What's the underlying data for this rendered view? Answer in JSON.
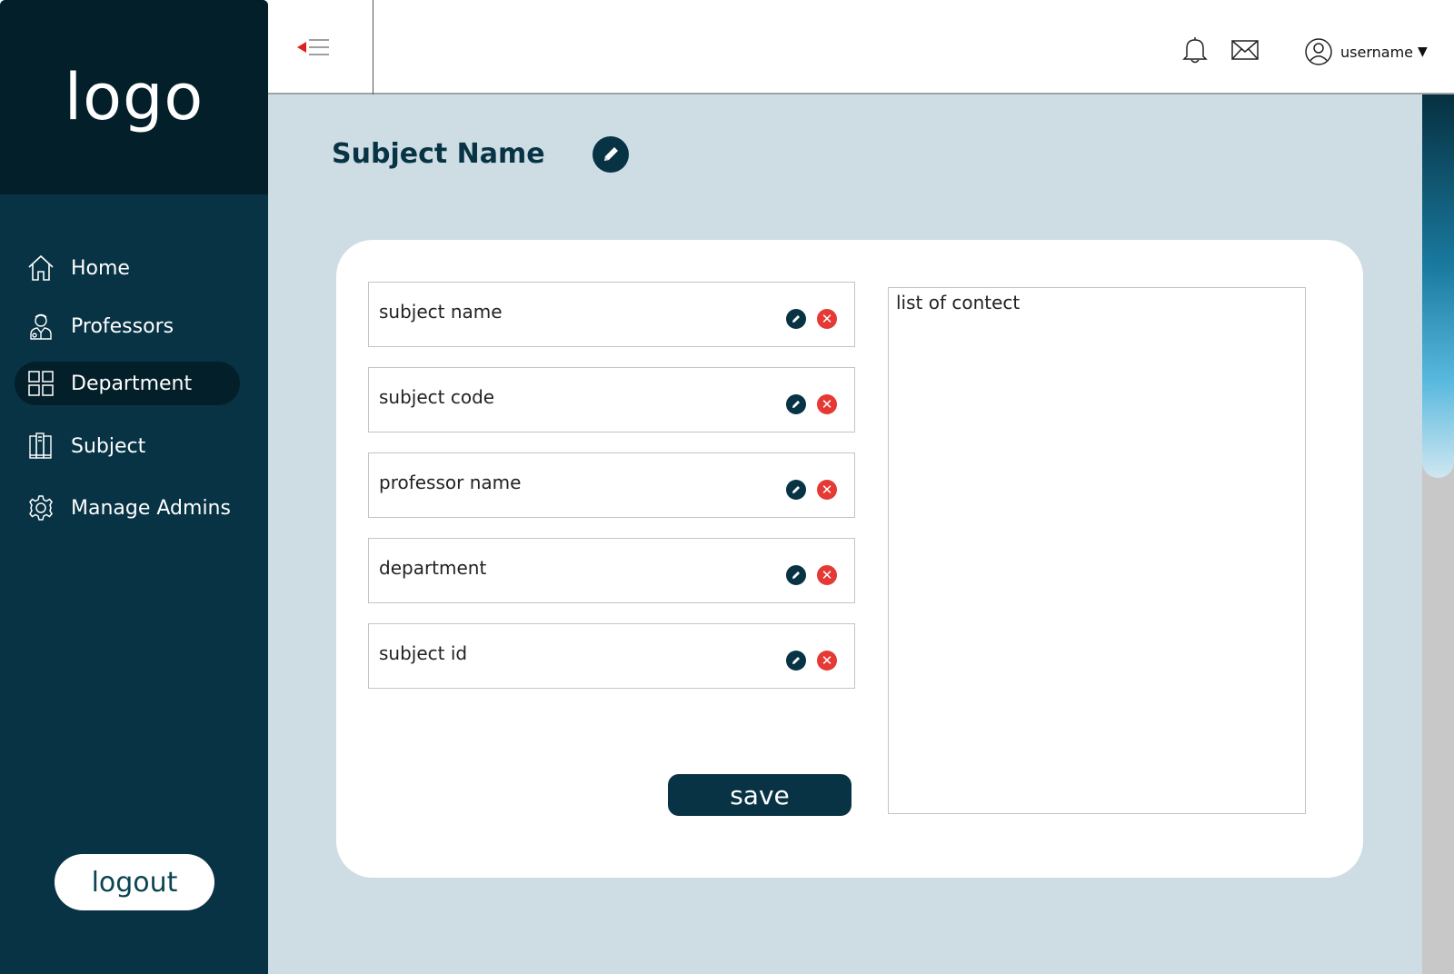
{
  "sidebar": {
    "logo": "logo",
    "items": [
      {
        "label": "Home",
        "icon": "home-icon"
      },
      {
        "label": "Professors",
        "icon": "professor-icon"
      },
      {
        "label": "Department",
        "icon": "grid-icon",
        "active": true
      },
      {
        "label": "Subject",
        "icon": "book-icon"
      },
      {
        "label": "Manage Admins",
        "icon": "gear-icon"
      }
    ],
    "logout_label": "logout"
  },
  "header": {
    "username": "username",
    "icons": [
      "menu-toggle-icon",
      "bell-icon",
      "mail-icon",
      "user-icon"
    ]
  },
  "main": {
    "title": "Subject Name",
    "fields": [
      {
        "label": "subject name"
      },
      {
        "label": "subject code"
      },
      {
        "label": "professor name"
      },
      {
        "label": "department"
      },
      {
        "label": "subject id"
      }
    ],
    "save_label": "save",
    "content_label": "list of contect"
  },
  "colors": {
    "sidebar_bg": "#083344",
    "logo_bg": "#031f29",
    "main_bg": "#cddde3",
    "accent": "#083344",
    "delete": "#e53935"
  }
}
